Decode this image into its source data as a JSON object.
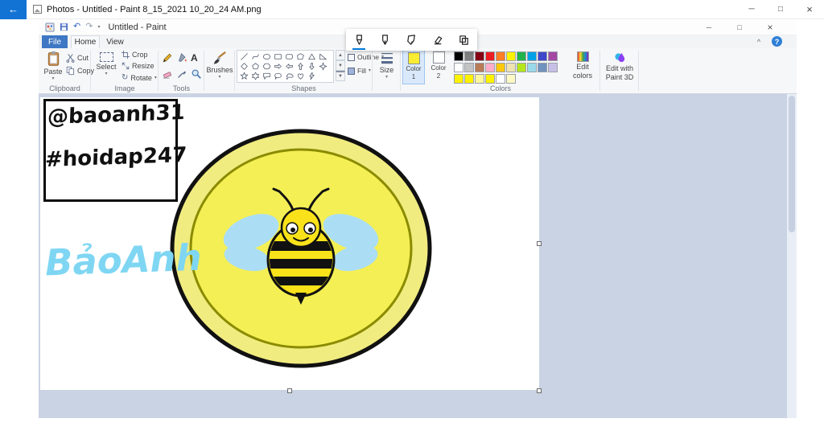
{
  "photos": {
    "title": "Photos - Untitled - Paint 8_15_2021 10_20_24 AM.png"
  },
  "icons": {
    "back": "←",
    "minimize": "─",
    "maximize": "□",
    "close": "×",
    "dropdown": "▾",
    "undo": "↶",
    "redo": "↷",
    "rotate": "↻",
    "help": "?",
    "chevron_up": "^",
    "scroll_up": "▲",
    "scroll_down": "▼",
    "gallery_expand": "▼"
  },
  "overlay": {
    "tools": [
      "ballpoint-pen",
      "pencil",
      "calligraphy-pen",
      "eraser",
      "copy-clip"
    ]
  },
  "paint": {
    "title": "Untitled - Paint",
    "tabs": {
      "file": "File",
      "home": "Home",
      "view": "View"
    },
    "clipboard": {
      "group": "Clipboard",
      "paste": "Paste",
      "cut": "Cut",
      "copy": "Copy"
    },
    "image": {
      "group": "Image",
      "select": "Select",
      "crop": "Crop",
      "resize": "Resize",
      "rotate": "Rotate"
    },
    "tools": {
      "group": "Tools"
    },
    "brushes": {
      "label": "Brushes"
    },
    "shapes": {
      "group": "Shapes",
      "outline": "Outline",
      "fill": "Fill",
      "gallery": [
        "line",
        "curve",
        "oval",
        "rectangle",
        "rounded-rectangle",
        "polygon",
        "triangle",
        "right-triangle",
        "diamond",
        "pentagon",
        "hexagon",
        "arrow-right",
        "arrow-left",
        "arrow-up",
        "arrow-down",
        "star-4",
        "star-5",
        "star-6",
        "callout-rectangle",
        "callout-oval",
        "callout-cloud",
        "heart",
        "lightning"
      ]
    },
    "size": {
      "label": "Size"
    },
    "colors": {
      "group": "Colors",
      "color1_line1": "Color",
      "color1_line2": "1",
      "color2_line1": "Color",
      "color2_line2": "2",
      "color1": "#f9ec31",
      "color2": "#ffffff",
      "row1": [
        "#000000",
        "#7f7f7f",
        "#870014",
        "#ec1c23",
        "#ff7e26",
        "#fef200",
        "#22b24c",
        "#00a1e7",
        "#3f47cb",
        "#a349a4"
      ],
      "row2": [
        "#ffffff",
        "#c3c3c3",
        "#b97a56",
        "#feaec9",
        "#fec90d",
        "#efe4b0",
        "#b5e61d",
        "#99d9ea",
        "#7092be",
        "#c8bfe7"
      ],
      "row3": [
        "#fef200",
        "#fef200",
        "#fdf89e",
        "#fef200",
        "#ffffff",
        "#fdf9c4"
      ],
      "edit_colors_line1": "Edit",
      "edit_colors_line2": "colors",
      "paint3d_line1": "Edit with",
      "paint3d_line2": "Paint 3D"
    }
  },
  "canvas": {
    "box_line1": "@baoanh31",
    "box_line2": "#hoidap247",
    "signature": "BảoAnh",
    "coin": {
      "ring": "#f1ec80",
      "face": "#f4ef55",
      "edge": "#8b8b00",
      "outline": "#111111"
    },
    "bee": {
      "body": "#f9e21a",
      "wing": "#abdef5"
    }
  }
}
